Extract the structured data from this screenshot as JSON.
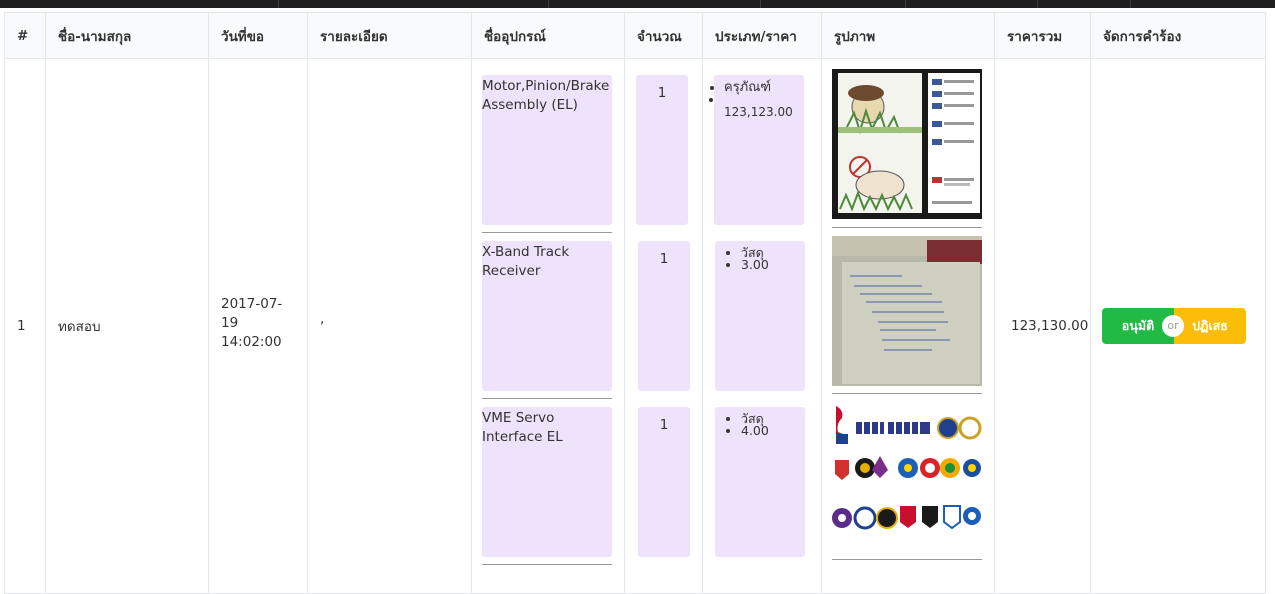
{
  "table": {
    "headers": [
      "#",
      "ชื่อ-นามสกุล",
      "วันที่ขอ",
      "รายละเอียด",
      "ชื่ออุปกรณ์",
      "จำนวณ",
      "ประเภท/ราคา",
      "รูปภาพ",
      "ราคารวม",
      "จัดการคำร้อง"
    ],
    "row": {
      "index": "1",
      "name": "ทดสอบ",
      "date": "2017-07-19",
      "time": "14:02:00",
      "detail": ",",
      "total": "123,130.00",
      "items": [
        {
          "name": "Motor,Pinion/Brake Assembly (EL)",
          "qty": "1",
          "type": "ครุภัณฑ์",
          "price": "123,123.00",
          "image": "comic-screenshot-image"
        },
        {
          "name": "X-Band Track Receiver",
          "qty": "1",
          "type": "วัสดุ",
          "price": "3.00",
          "image": "handwritten-paper-image"
        },
        {
          "name": "VME Servo Interface EL",
          "qty": "1",
          "type": "วัสดุ",
          "price": "4.00",
          "image": "thai-league-logos-image"
        }
      ]
    }
  },
  "actions": {
    "approve_label": "อนุมัติ",
    "or_label": "or",
    "reject_label": "ปฏิเสธ"
  },
  "colors": {
    "approve": "#21ba45",
    "reject": "#fbbd08",
    "item_block": "#efe3fb",
    "top_bar": "#1f1f1f"
  }
}
